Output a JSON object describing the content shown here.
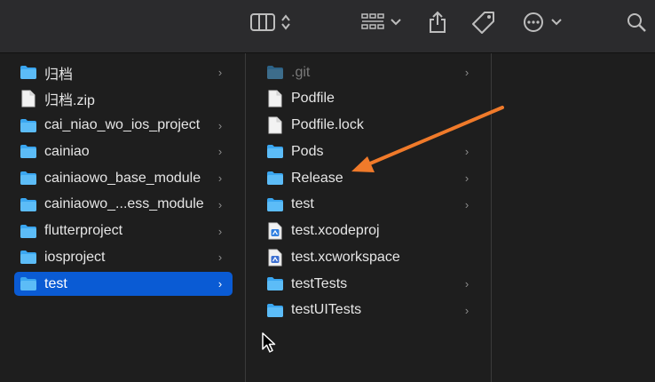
{
  "toolbar": {
    "buttons": [
      {
        "name": "view-mode",
        "icon": "columns-view-icon"
      },
      {
        "name": "group",
        "icon": "grid-group-icon"
      },
      {
        "name": "share",
        "icon": "share-icon"
      },
      {
        "name": "tags",
        "icon": "tag-icon"
      },
      {
        "name": "more",
        "icon": "ellipsis-circle-icon"
      },
      {
        "name": "search",
        "icon": "search-icon"
      }
    ]
  },
  "column1": {
    "items": [
      {
        "label": "归档",
        "type": "folder",
        "has_children": true
      },
      {
        "label": "归档.zip",
        "type": "file",
        "has_children": false
      },
      {
        "label": "cai_niao_wo_ios_project",
        "type": "folder",
        "has_children": true
      },
      {
        "label": "cainiao",
        "type": "folder",
        "has_children": true
      },
      {
        "label": "cainiaowo_base_module",
        "type": "folder",
        "has_children": true
      },
      {
        "label": "cainiaowo_...ess_module",
        "type": "folder",
        "has_children": true
      },
      {
        "label": "flutterproject",
        "type": "folder",
        "has_children": true
      },
      {
        "label": "iosproject",
        "type": "folder",
        "has_children": true
      },
      {
        "label": "test",
        "type": "folder",
        "has_children": true,
        "selected": true
      }
    ]
  },
  "column2": {
    "items": [
      {
        "label": ".git",
        "type": "folder",
        "has_children": true,
        "dim": true
      },
      {
        "label": "Podfile",
        "type": "file",
        "has_children": false
      },
      {
        "label": "Podfile.lock",
        "type": "file",
        "has_children": false
      },
      {
        "label": "Pods",
        "type": "folder",
        "has_children": true
      },
      {
        "label": "Release",
        "type": "folder",
        "has_children": true
      },
      {
        "label": "test",
        "type": "folder",
        "has_children": true
      },
      {
        "label": "test.xcodeproj",
        "type": "xcodeproj",
        "has_children": false
      },
      {
        "label": "test.xcworkspace",
        "type": "xcworkspace",
        "has_children": false
      },
      {
        "label": "testTests",
        "type": "folder",
        "has_children": true
      },
      {
        "label": "testUITests",
        "type": "folder",
        "has_children": true
      }
    ]
  },
  "colors": {
    "selection": "#0a5bd4",
    "folder": "#3aa6f0",
    "arrow": "#f07a2a"
  }
}
